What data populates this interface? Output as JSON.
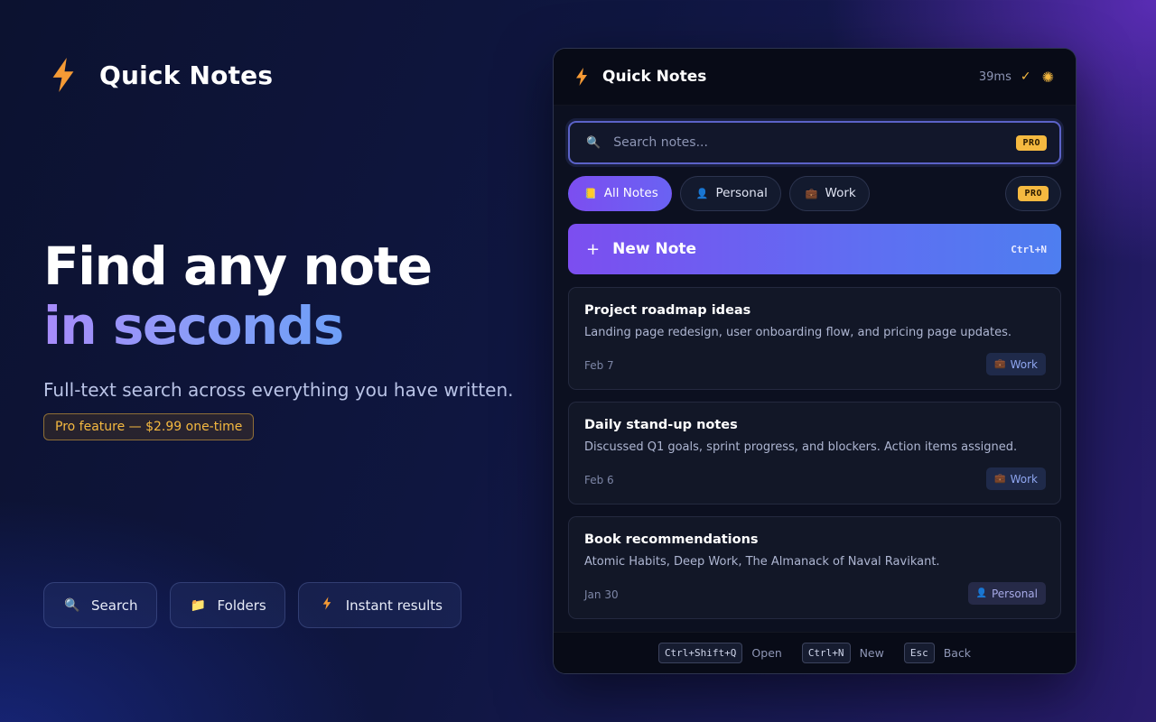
{
  "brand": {
    "name": "Quick Notes"
  },
  "hero": {
    "title_line1": "Find any note",
    "title_line2": "in seconds",
    "subtitle": "Full-text search across everything you have written.",
    "pro_pill": "Pro feature — $2.99 one-time"
  },
  "features": [
    {
      "label": "Search",
      "icon": "magnifier-icon"
    },
    {
      "label": "Folders",
      "icon": "folder-icon"
    },
    {
      "label": "Instant results",
      "icon": "bolt-icon"
    }
  ],
  "window": {
    "title": "Quick Notes",
    "timing": "39ms",
    "search": {
      "placeholder": "Search notes...",
      "badge": "PRO"
    },
    "filters": [
      {
        "label": "All Notes",
        "icon": "notepad-icon",
        "active": true
      },
      {
        "label": "Personal",
        "icon": "person-icon",
        "active": false
      },
      {
        "label": "Work",
        "icon": "briefcase-icon",
        "active": false
      }
    ],
    "filters_pro_badge": "PRO",
    "new_note": {
      "label": "New Note",
      "shortcut": "Ctrl+N"
    },
    "notes": [
      {
        "title": "Project roadmap ideas",
        "preview": "Landing page redesign, user onboarding flow, and pricing page updates.",
        "date": "Feb 7",
        "tag": "Work"
      },
      {
        "title": "Daily stand-up notes",
        "preview": "Discussed Q1 goals, sprint progress, and blockers. Action items assigned.",
        "date": "Feb 6",
        "tag": "Work"
      },
      {
        "title": "Book recommendations",
        "preview": "Atomic Habits, Deep Work, The Almanack of Naval Ravikant.",
        "date": "Jan 30",
        "tag": "Personal"
      }
    ],
    "footer": [
      {
        "key": "Ctrl+Shift+Q",
        "label": "Open"
      },
      {
        "key": "Ctrl+N",
        "label": "New"
      },
      {
        "key": "Esc",
        "label": "Back"
      }
    ]
  },
  "colors": {
    "accent_purple": "#7c4ef0",
    "accent_blue": "#4e7ef0",
    "pro_gold": "#f5b940",
    "window_bg": "#0c1020"
  }
}
